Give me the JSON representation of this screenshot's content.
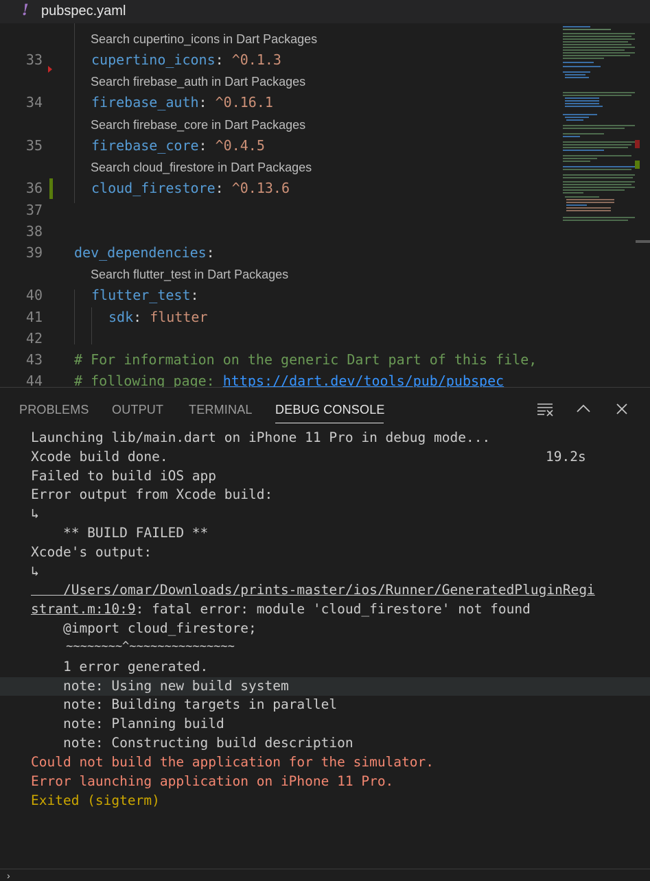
{
  "tab": {
    "icon": "!",
    "filename": "pubspec.yaml"
  },
  "editor": {
    "lines": [
      {
        "n": "33",
        "lens": "Search cupertino_icons in Dart Packages",
        "key": "cupertino_icons",
        "value": "^0.1.3"
      },
      {
        "n": "34",
        "lens": "Search firebase_auth in Dart Packages",
        "key": "firebase_auth",
        "value": "^0.16.1"
      },
      {
        "n": "35",
        "lens": "Search firebase_core in Dart Packages",
        "key": "firebase_core",
        "value": "^0.4.5"
      },
      {
        "n": "36",
        "lens": "Search cloud_firestore in Dart Packages",
        "key": "cloud_firestore",
        "value": "^0.13.6"
      },
      {
        "n": "37"
      },
      {
        "n": "38"
      },
      {
        "n": "39",
        "key": "dev_dependencies"
      },
      {
        "n": "40",
        "lens": "Search flutter_test in Dart Packages",
        "key": "flutter_test"
      },
      {
        "n": "41",
        "key": "sdk",
        "value": "flutter"
      },
      {
        "n": "42"
      },
      {
        "n": "43",
        "comment": "# For information on the generic Dart part of this file,"
      },
      {
        "n": "44",
        "comment": "# following page: ",
        "link": "https://dart.dev/tools/pub/pubspec"
      }
    ]
  },
  "panel": {
    "tabs": [
      "PROBLEMS",
      "OUTPUT",
      "TERMINAL",
      "DEBUG CONSOLE"
    ],
    "active_tab": "DEBUG CONSOLE",
    "icons": [
      "clear-console-icon",
      "chevron-up-icon",
      "close-icon"
    ],
    "timing": "19.2s",
    "output": [
      {
        "text": "Launching lib/main.dart on iPhone 11 Pro in debug mode...",
        "kind": "normal"
      },
      {
        "text": "Xcode build done.",
        "kind": "normal"
      },
      {
        "text": "Failed to build iOS app",
        "kind": "normal"
      },
      {
        "text": "Error output from Xcode build:",
        "kind": "normal"
      },
      {
        "text": "↳",
        "kind": "normal"
      },
      {
        "text": "    ** BUILD FAILED **",
        "kind": "normal"
      },
      {
        "text": "Xcode's output:",
        "kind": "normal"
      },
      {
        "text": "↳",
        "kind": "normal"
      },
      {
        "text": "    /Users/omar/Downloads/prints-master/ios/Runner/GeneratedPluginRegi",
        "kind": "link"
      },
      {
        "text": "strant.m:10:9",
        "kind": "link",
        "rest": ": fatal error: module 'cloud_firestore' not found"
      },
      {
        "text": "    @import cloud_firestore;",
        "kind": "normal"
      },
      {
        "text": "     ~~~~~~~~^~~~~~~~~~~~~~~~",
        "kind": "normal"
      },
      {
        "text": "    1 error generated.",
        "kind": "normal"
      },
      {
        "text": "    note: Using new build system",
        "kind": "normal"
      },
      {
        "text": "    note: Building targets in parallel",
        "kind": "normal"
      },
      {
        "text": "    note: Planning build",
        "kind": "normal"
      },
      {
        "text": "    note: Constructing build description",
        "kind": "normal"
      },
      {
        "text": "Could not build the application for the simulator.",
        "kind": "err"
      },
      {
        "text": "Error launching application on iPhone 11 Pro.",
        "kind": "err"
      },
      {
        "text": "Exited (sigterm)",
        "kind": "warn"
      }
    ],
    "prompt": "›"
  }
}
